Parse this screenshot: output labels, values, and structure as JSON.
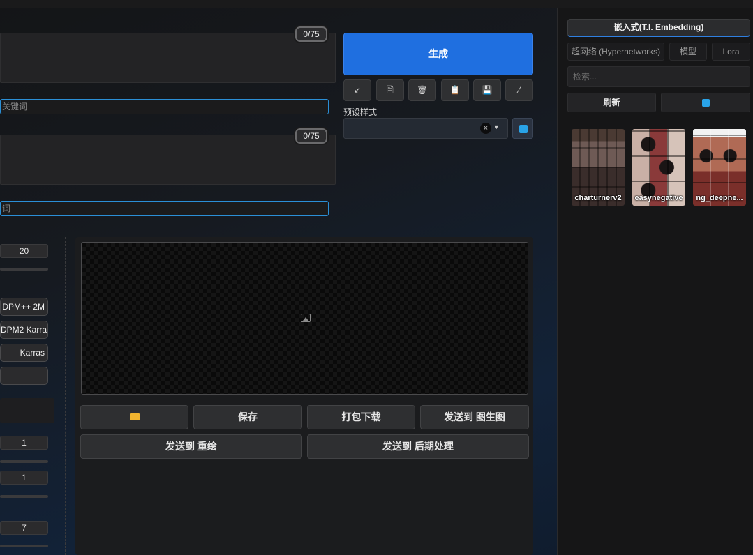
{
  "prompt": {
    "positive_counter": "0/75",
    "negative_counter": "0/75",
    "positive_hint": "关键词",
    "negative_hint": "词"
  },
  "generate": {
    "label": "生成"
  },
  "toolbar": {
    "icons": [
      "arrow-down-left-icon",
      "document-icon",
      "trash-icon",
      "clipboard-icon",
      "save-icon",
      "magic-wand-icon"
    ],
    "glyphs": [
      "↙",
      "🗎",
      "🗑",
      "📋",
      "💾",
      "⁄"
    ]
  },
  "styles": {
    "label": "预设样式",
    "clear": "×",
    "caret": "▼"
  },
  "settings": {
    "steps": "20",
    "samplers": [
      "DPM++ 2M",
      "DPM2 Karras",
      "Karras"
    ],
    "batch_count": "1",
    "batch_size": "1",
    "cfg": "7"
  },
  "output": {
    "buttons": {
      "open_folder": "",
      "save": "保存",
      "zip": "打包下载",
      "to_img2img": "发送到 图生图",
      "to_inpaint": "发送到 重绘",
      "to_extras": "发送到 后期处理"
    }
  },
  "extra_networks": {
    "tabs": {
      "embedding": "嵌入式(T.I. Embedding)",
      "hypernetworks": "超网络 (Hypernetworks)",
      "checkpoints": "模型",
      "lora": "Lora"
    },
    "search_placeholder": "检索...",
    "refresh": "刷新",
    "cards": [
      {
        "name": "charturnerv2"
      },
      {
        "name": "easynegative"
      },
      {
        "name": "ng_deepne..."
      }
    ]
  },
  "colors": {
    "accent": "#1f6fe0",
    "input_focus": "#2b8fd6",
    "folder": "#f1b42f"
  }
}
